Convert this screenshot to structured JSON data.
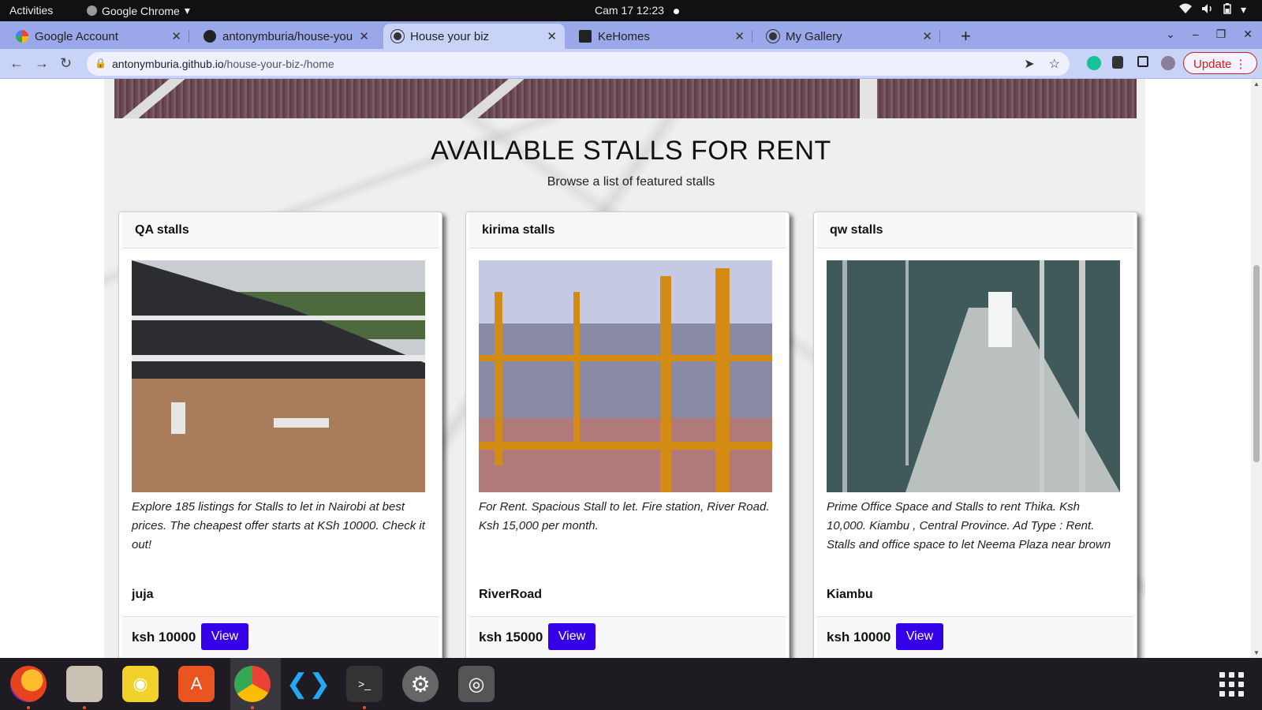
{
  "topbar": {
    "activities": "Activities",
    "app_name": "Google Chrome",
    "clock": "Cam 17  12:23"
  },
  "tabs": [
    {
      "title": "Google Account",
      "favicon": "google-icon"
    },
    {
      "title": "antonymburia/house-you",
      "favicon": "github-icon"
    },
    {
      "title": "House your biz",
      "favicon": "globe-icon",
      "active": true
    },
    {
      "title": "KeHomes",
      "favicon": "angular-icon"
    },
    {
      "title": "My Gallery",
      "favicon": "globe-icon"
    }
  ],
  "omnibox": {
    "domain": "antonymburia.github.io",
    "path": "/house-your-biz-/home"
  },
  "toolbar": {
    "update_label": "Update"
  },
  "page": {
    "heading": "AVAILABLE STALLS FOR RENT",
    "subheading": "Browse a list of featured stalls",
    "cards": [
      {
        "name": "QA stalls",
        "description": "Explore 185 listings for Stalls to let in Nairobi at best prices. The cheapest offer starts at KSh 10000. Check it out!",
        "location": "juja",
        "price": "ksh 10000",
        "button": "View"
      },
      {
        "name": "kirima stalls",
        "description": "For Rent. Spacious Stall to let. Fire station, River Road. Ksh 15,000 per month.",
        "location": "RiverRoad",
        "price": "ksh 15000",
        "button": "View"
      },
      {
        "name": "qw stalls",
        "description": "Prime Office Space and Stalls to rent Thika. Ksh 10,000. Kiambu , Central Province. Ad Type : Rent. Stalls and office space to let Neema Plaza near brown",
        "location": "Kiambu",
        "price": "ksh 10000",
        "button": "View"
      }
    ]
  },
  "colors": {
    "accent_button": "#3400e8",
    "tab_strip": "#9aa7e8",
    "update_red": "#c5221f"
  }
}
